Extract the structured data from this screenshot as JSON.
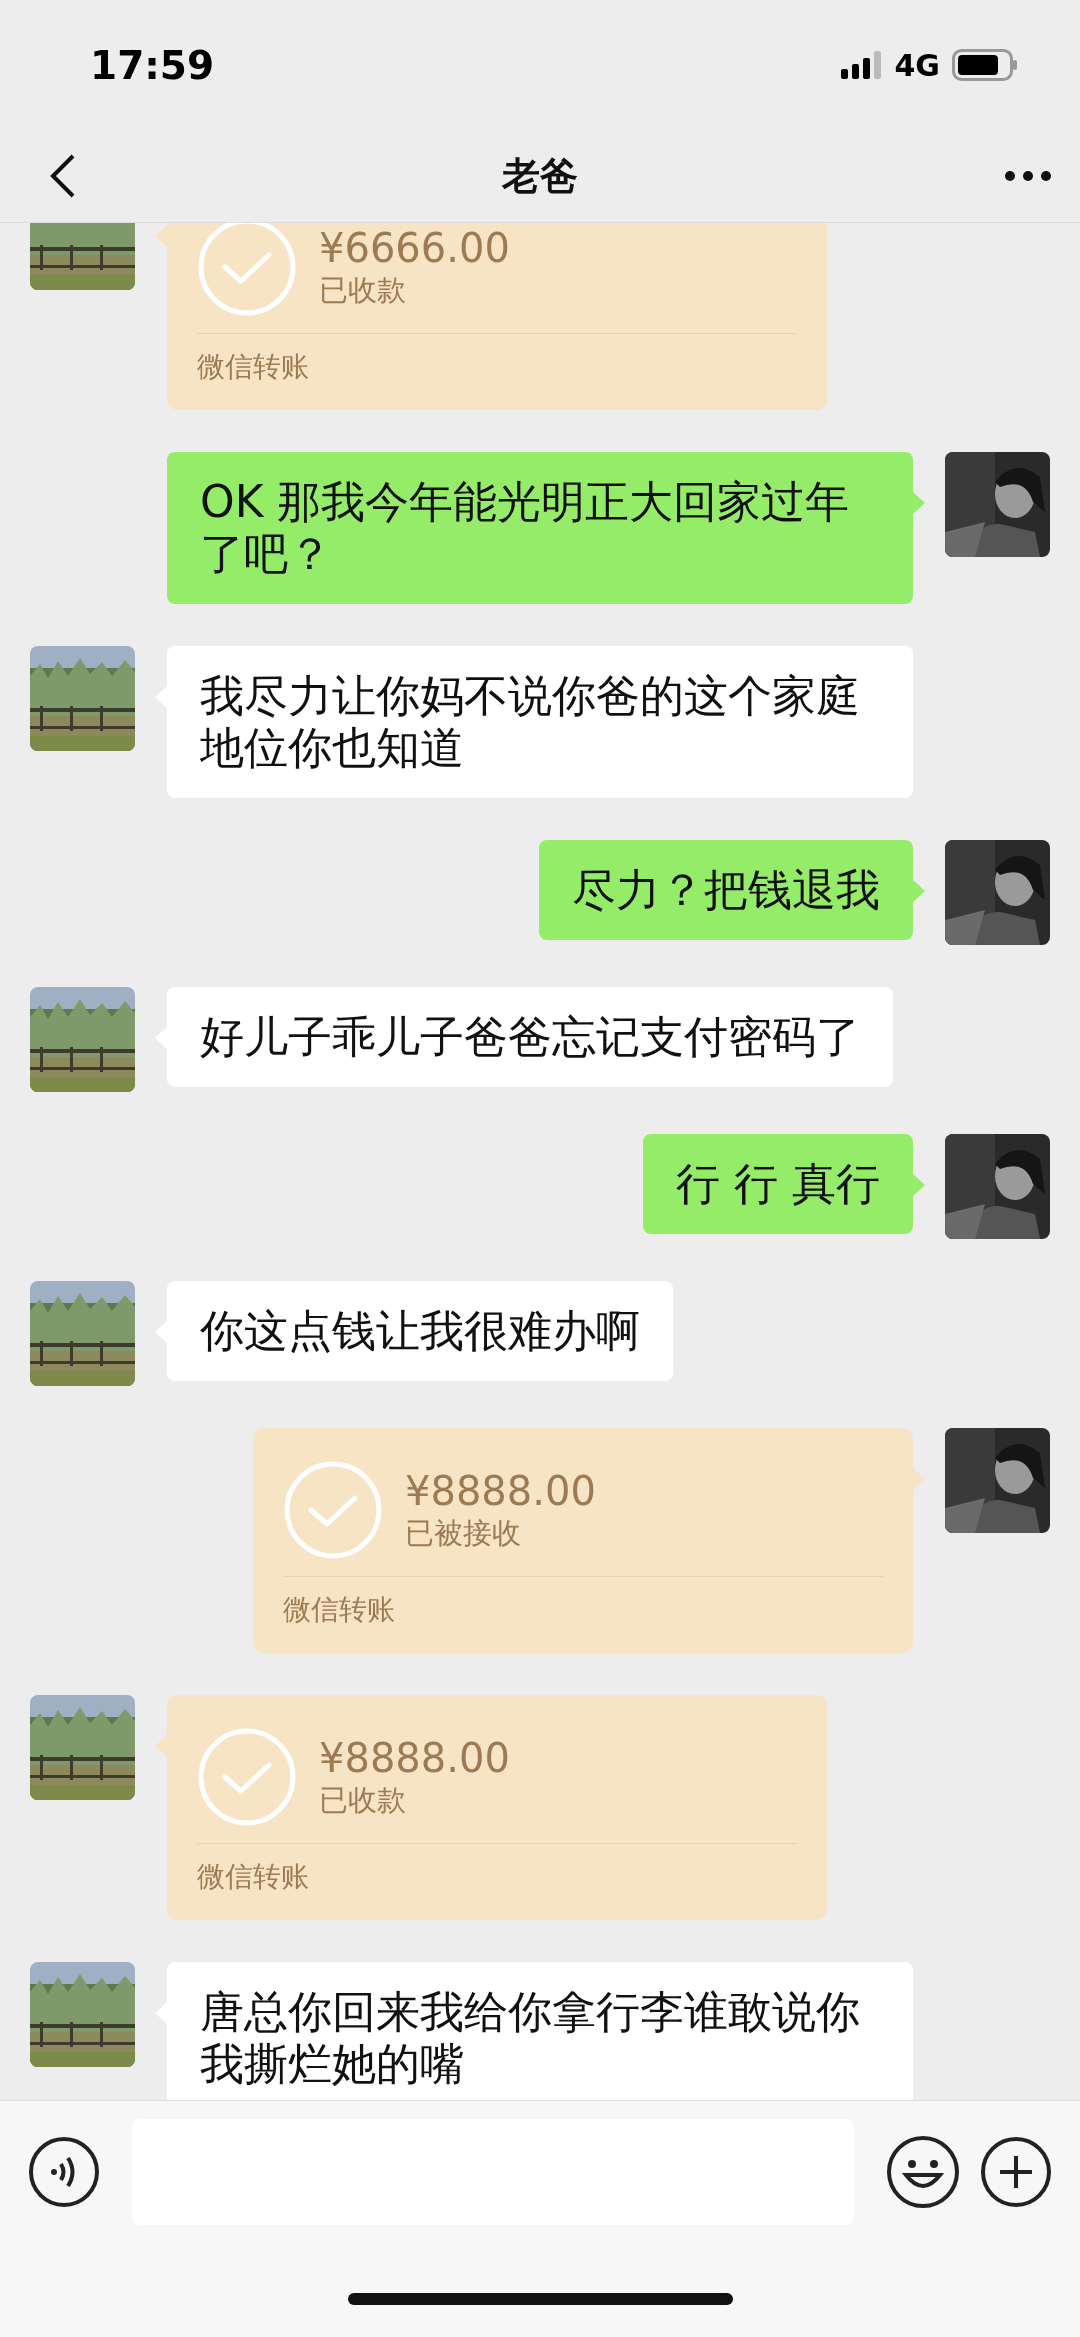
{
  "status_bar": {
    "time": "17:59",
    "network": "4G"
  },
  "nav": {
    "title": "老爸"
  },
  "messages": [
    {
      "kind": "transfer",
      "outgoing": false,
      "amount": "¥6666.00",
      "status": "已收款",
      "label": "微信转账"
    },
    {
      "kind": "text",
      "outgoing": true,
      "text": "OK 那我今年能光明正大回家过年了吧？"
    },
    {
      "kind": "text",
      "outgoing": false,
      "text": "我尽力让你妈不说你爸的这个家庭地位你也知道"
    },
    {
      "kind": "text",
      "outgoing": true,
      "text": "尽力？把钱退我"
    },
    {
      "kind": "text",
      "outgoing": false,
      "text": "好儿子乖儿子爸爸忘记支付密码了"
    },
    {
      "kind": "text",
      "outgoing": true,
      "text": "行 行 真行"
    },
    {
      "kind": "text",
      "outgoing": false,
      "text": "你这点钱让我很难办啊"
    },
    {
      "kind": "transfer",
      "outgoing": true,
      "amount": "¥8888.00",
      "status": "已被接收",
      "label": "微信转账"
    },
    {
      "kind": "transfer",
      "outgoing": false,
      "amount": "¥8888.00",
      "status": "已收款",
      "label": "微信转账"
    },
    {
      "kind": "text",
      "outgoing": false,
      "text": "唐总你回来我给你拿行李谁敢说你我撕烂她的嘴"
    }
  ]
}
